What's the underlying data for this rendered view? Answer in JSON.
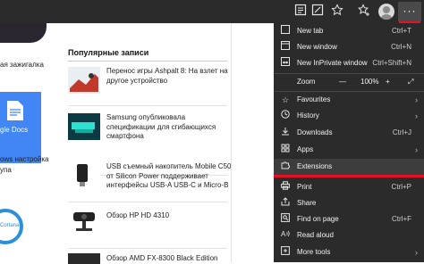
{
  "toolbar": {
    "reading_icon": "reading-view-icon",
    "favorite_icon": "star-icon",
    "favorites_bar_icon": "favorites-icon",
    "more_label": "···"
  },
  "left_column": {
    "snippet_1": "ая зажигалка",
    "docs_label": "gle Docs",
    "snippet_2": "ows настройка",
    "snippet_3": "упа",
    "cortana_label": "Cortana"
  },
  "page": {
    "section_title": "Популярные записи",
    "articles": [
      {
        "text": "Перенос игры Ashpalt 8: На взлет на другое устройство"
      },
      {
        "text": "Samsung опубликовала спецификации для сгибающихся смартфона"
      },
      {
        "text": "USB съемный накопитель Mobile C50 от Silicon Power поддерживает интерфейсы USB-A USB-C и Micro-B"
      },
      {
        "text": "Обзор HP HD 4310"
      },
      {
        "text": "Обзор AMD FX-8300 Black Edition"
      }
    ]
  },
  "menu": {
    "new_tab": {
      "label": "New tab",
      "shortcut": "Ctrl+T"
    },
    "new_window": {
      "label": "New window",
      "shortcut": "Ctrl+N"
    },
    "new_inprivate": {
      "label": "New InPrivate window",
      "shortcut": "Ctrl+Shift+N"
    },
    "zoom": {
      "label": "Zoom",
      "minus": "—",
      "value": "100%",
      "plus": "+",
      "fullscreen": "⤢"
    },
    "favourites": {
      "label": "Favourites"
    },
    "history": {
      "label": "History"
    },
    "downloads": {
      "label": "Downloads",
      "shortcut": "Ctrl+J"
    },
    "apps": {
      "label": "Apps"
    },
    "extensions": {
      "label": "Extensions"
    },
    "print": {
      "label": "Print",
      "shortcut": "Ctrl+P"
    },
    "share": {
      "label": "Share"
    },
    "find": {
      "label": "Find on page",
      "shortcut": "Ctrl+F"
    },
    "read_aloud": {
      "label": "Read aloud"
    },
    "more_tools": {
      "label": "More tools"
    }
  },
  "colors": {
    "accent_red": "#e81123",
    "menu_bg": "#2b2b2b"
  }
}
